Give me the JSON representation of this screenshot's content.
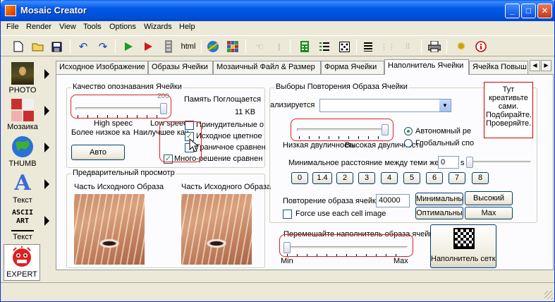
{
  "window": {
    "title": "Mosaic Creator",
    "minimize": "_",
    "maximize": "□",
    "close": "✕"
  },
  "menu": [
    "File",
    "Render",
    "View",
    "Tools",
    "Options",
    "Wizards",
    "Help"
  ],
  "toolbar": {
    "html_label": "html"
  },
  "sidebar": [
    {
      "label": "PHOTO"
    },
    {
      "label": "Мозаика"
    },
    {
      "label": "THUMB"
    },
    {
      "label": "Текст",
      "glyph": "A"
    },
    {
      "label": "Текст",
      "glyph": "ASCII ART"
    },
    {
      "label": "EXPERT"
    }
  ],
  "tabs": [
    "Исходное Изображение",
    "Образы Ячейки",
    "Мозаичный Файл & Размер",
    "Форма Ячейки",
    "Наполнитель Ячейки",
    "Ячейка Повыш"
  ],
  "tab_scroll": {
    "left": "◀",
    "right": "▶"
  },
  "quality": {
    "title": "Качество опознавания Ячейки",
    "slider_value": "200",
    "left_label": "High speec",
    "right_label": "Low speec",
    "low_label": "Более низкое ка",
    "best_label": "Наилучшее кач",
    "memory_label": "Память Поглощается",
    "memory_value": "11 KB",
    "auto_button": "Авто",
    "checks": [
      {
        "label": "Принудительные о",
        "checked": false
      },
      {
        "label": "Исходное цветное",
        "checked": true
      },
      {
        "label": "Граничное сравнен",
        "checked": false
      },
      {
        "label": "Много-решение сравнен",
        "checked": true
      }
    ],
    "check_mark": "✓"
  },
  "preview": {
    "title": "Предварительный просмотр",
    "left_caption": "Часть Исходного Образа",
    "right_caption": "Часть Исходного Образа"
  },
  "repeat": {
    "title": "Выборы Повторения Образа Ячейки",
    "dropdown_label": "ализируется",
    "dropdown_value": "",
    "dropdown_arrow": "▼",
    "slider_low": "Низкая двуличность",
    "slider_high": "Высокая двуличность",
    "radio_auto": "Автономный ре",
    "radio_global": "Глобальный спо",
    "min_distance_label": "Минимальное расстояние между теми же",
    "min_distance_value": "0",
    "min_distance_unit": "s",
    "distance_buttons": [
      "0",
      "1.4",
      "2",
      "3",
      "4",
      "5",
      "6",
      "7",
      "8"
    ],
    "repeat_label": "Повторение образа ячейки",
    "repeat_value": "40000",
    "btn_minimal": "Минимальны",
    "btn_high": "Высокий",
    "btn_optimal": "Оптимальны",
    "btn_max": "Max",
    "force_label": "Force use each cell image"
  },
  "filler": {
    "label": "Перемешайте наполнитель образа ячейки",
    "min_label": "Min",
    "max_label": "Max",
    "grid_button": "Наполнитель сетки"
  },
  "tip": {
    "lines": [
      "Тут",
      "креативьте",
      "сами.",
      "Подбирайте.",
      "Проверяйте."
    ]
  },
  "colors": {
    "title_blue": "#0054e3",
    "highlight_red": "#e02020",
    "check_green": "#21a121"
  }
}
